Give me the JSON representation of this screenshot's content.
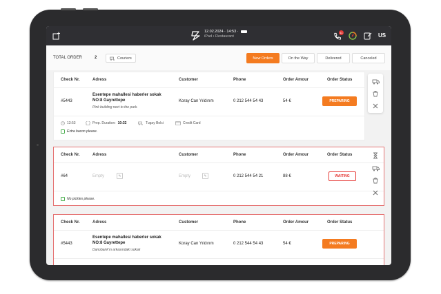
{
  "topbar": {
    "date_time": "12.02.2024 · 14:53 ·",
    "location": "iPad • Restaurant",
    "notification_count": "11",
    "user_initials": "US",
    "icons": [
      "new-window-icon",
      "app-logo-icon",
      "phone-icon",
      "gauge-icon",
      "edit-icon"
    ]
  },
  "filters": {
    "total_label": "TOTAL ORDER",
    "total_count": "2",
    "couriers_label": "Couriers",
    "tabs": [
      "New Orders",
      "On the Way",
      "Delivered",
      "Canceled"
    ],
    "active_tab": "New Orders"
  },
  "columns": [
    "Check Nr.",
    "Adress",
    "Customer",
    "Phone",
    "Order Amour",
    "Order Status"
  ],
  "orders": [
    {
      "check": "#5443",
      "address_line1": "Esentepe mahallesi haberler sokak",
      "address_line2": "NO:8 Gayrettepe",
      "address_note": "Pink building next to the park.",
      "customer": "Koray Can Yıldırım",
      "phone": "0 212 544 54 43",
      "amount": "54 €",
      "status": "PREPARING",
      "time": "13:53",
      "prep_label": "Prep. Duration:",
      "prep_value": "10:32",
      "courier": "Tugay Bolci",
      "payment": "Credit Card",
      "extra": "Extra bacon please."
    },
    {
      "check": "#64",
      "address_placeholder": "Empty",
      "customer_placeholder": "Empty",
      "phone": "0 212 544 54 21",
      "amount": "88 €",
      "status": "WAITING",
      "extra": "No pickles please."
    },
    {
      "check": "#5443",
      "address_line1": "Esentepe mahallesi haberler sokak",
      "address_line2": "NO:8 Gayrettepe",
      "address_note": "Danobank'ın arkasındaki sokak",
      "customer": "Koray Can Yıldırım",
      "phone": "0 212 544 54 43",
      "amount": "54 €",
      "status": "PREPARING"
    }
  ],
  "colors": {
    "accent": "#f47b20",
    "alert": "#e53935",
    "topbar": "#2f2f33"
  }
}
